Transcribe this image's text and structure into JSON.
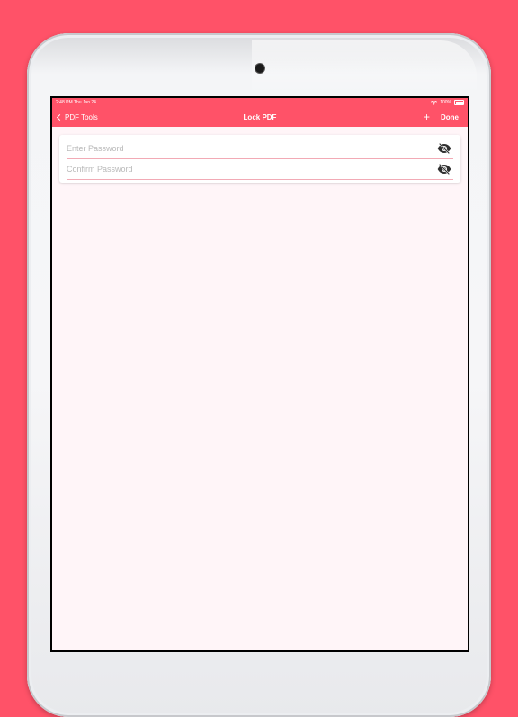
{
  "status_bar": {
    "time_date": "2:48 PM  Thu Jan 24",
    "battery": "100%"
  },
  "nav": {
    "back_label": "PDF Tools",
    "title": "Lock PDF",
    "done_label": "Done"
  },
  "form": {
    "password": {
      "placeholder": "Enter Password",
      "value": ""
    },
    "confirm": {
      "placeholder": "Confirm Password",
      "value": ""
    }
  },
  "icons": {
    "back": "chevron-left-icon",
    "add": "plus-icon",
    "toggle_visibility": "eye-slash-icon",
    "wifi": "wifi-icon",
    "battery": "battery-icon"
  },
  "colors": {
    "accent": "#ff5268",
    "background": "#fff5f8",
    "field_underline": "#f2aab5",
    "placeholder": "#b9b9b9"
  }
}
